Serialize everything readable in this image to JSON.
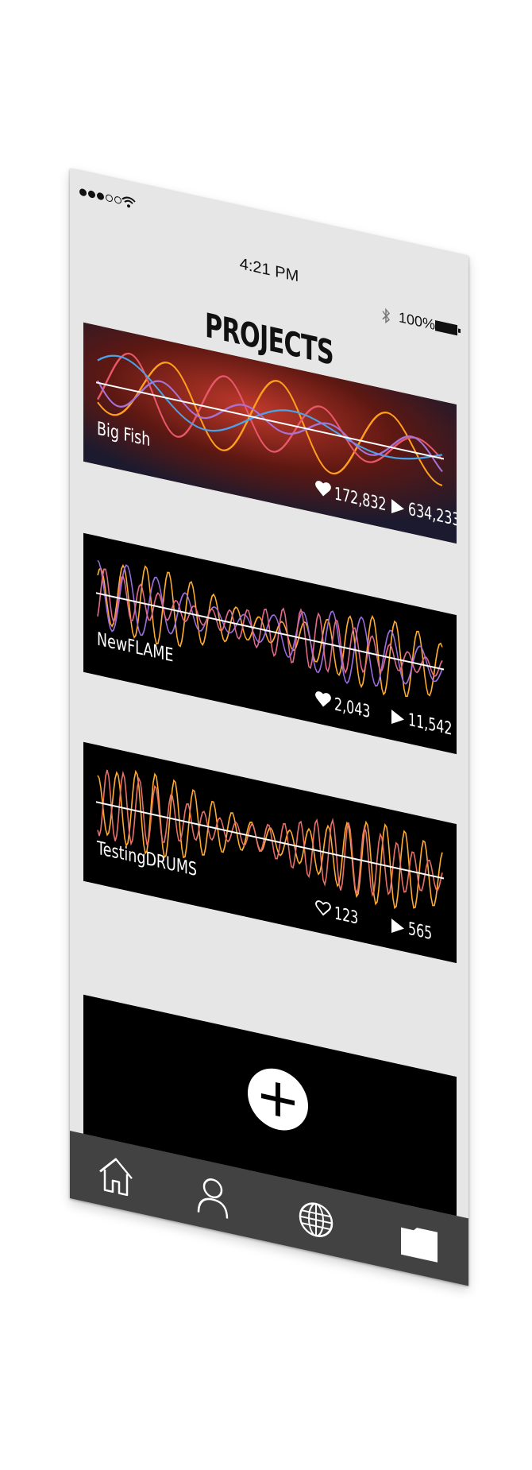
{
  "status_bar": {
    "time": "4:21 PM",
    "battery": "100%",
    "signal_filled": 3,
    "signal_total": 5
  },
  "page_title": "PROJECTS",
  "projects": [
    {
      "name": "Big Fish",
      "likes": "172,832",
      "plays": "634,233",
      "liked": true,
      "wave_colors": [
        "#ff9f1c",
        "#e8586a",
        "#4aa3e8",
        "#a774d6"
      ]
    },
    {
      "name": "NewFLAME",
      "likes": "2,043",
      "plays": "11,542",
      "liked": true,
      "wave_colors": [
        "#ffab2e",
        "#9b6ee0",
        "#e06a8a"
      ]
    },
    {
      "name": "TestingDRUMS",
      "likes": "123",
      "plays": "565",
      "liked": false,
      "wave_colors": [
        "#ffab2e",
        "#e8706a"
      ]
    }
  ],
  "add_project": {
    "icon": "plus-icon"
  },
  "tab_bar": [
    {
      "icon": "home-icon"
    },
    {
      "icon": "profile-icon"
    },
    {
      "icon": "globe-icon"
    },
    {
      "icon": "folder-icon"
    }
  ]
}
